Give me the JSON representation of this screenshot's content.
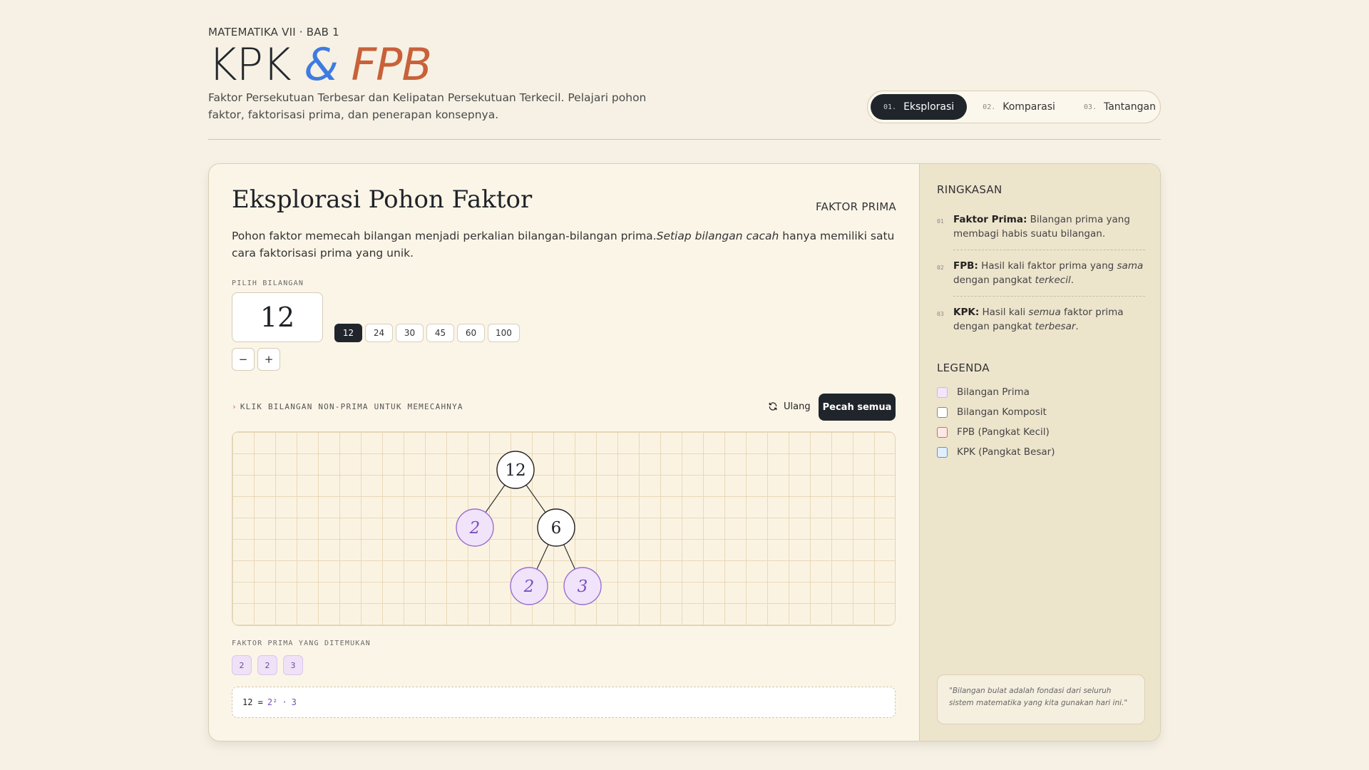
{
  "header": {
    "kicker": "MATEMATIKA VII · BAB 1",
    "title_a": "KPK ",
    "title_amp": "&",
    "title_b": " FPB",
    "subtitle": "Faktor Persekutuan Terbesar dan Kelipatan Persekutuan Terkecil. Pelajari pohon faktor, faktorisasi prima, dan penerapan konsepnya."
  },
  "tabs": [
    {
      "num": "01.",
      "label": "Eksplorasi",
      "active": true
    },
    {
      "num": "02.",
      "label": "Komparasi",
      "active": false
    },
    {
      "num": "03.",
      "label": "Tantangan",
      "active": false
    }
  ],
  "main": {
    "title": "Eksplorasi Pohon Faktor",
    "tag": "FAKTOR PRIMA",
    "para_a": "Pohon faktor memecah bilangan menjadi perkalian bilangan-bilangan prima.",
    "para_em": "Setiap bilangan cacah",
    "para_b": " hanya memiliki satu cara faktorisasi prima yang unik.",
    "pick_label": "PILIH BILANGAN",
    "value": "12",
    "minus": "−",
    "plus": "+",
    "presets": [
      "12",
      "24",
      "30",
      "45",
      "60",
      "100"
    ],
    "hint_arrow": "›",
    "hint": "KLIK BILANGAN NON-PRIMA UNTUK MEMECAHNYA",
    "reset_label": "Ulang",
    "split_all_label": "Pecah semua",
    "found_label": "FAKTOR PRIMA YANG DITEMUKAN",
    "found": [
      "2",
      "2",
      "3"
    ],
    "formula_lhs": "12 =",
    "formula_p1": "2²",
    "formula_dot": "·",
    "formula_p2": "3"
  },
  "tree": {
    "nodes": [
      {
        "label": "12",
        "kind": "composite"
      },
      {
        "label": "2",
        "kind": "prime"
      },
      {
        "label": "6",
        "kind": "composite"
      },
      {
        "label": "2",
        "kind": "prime"
      },
      {
        "label": "3",
        "kind": "prime"
      }
    ],
    "edges": [
      [
        0,
        1
      ],
      [
        0,
        2
      ],
      [
        2,
        3
      ],
      [
        2,
        4
      ]
    ]
  },
  "sidebar": {
    "summary_title": "RINGKASAN",
    "items": [
      {
        "num": "01",
        "term": "Faktor Prima:",
        "text": " Bilangan prima yang membagi habis suatu bilangan."
      },
      {
        "num": "02",
        "term": "FPB:",
        "t1": " Hasil kali faktor prima yang ",
        "e1": "sama",
        "t2": " dengan pangkat ",
        "e2": "terkecil",
        "t3": "."
      },
      {
        "num": "03",
        "term": "KPK:",
        "t1": " Hasil kali ",
        "e1": "semua",
        "t2": " faktor prima dengan pangkat ",
        "e2": "terbesar",
        "t3": "."
      }
    ],
    "legend_title": "LEGENDA",
    "legend": [
      {
        "label": "Bilangan Prima",
        "fill": "#f3e6fb",
        "border": "#d3b5ea"
      },
      {
        "label": "Bilangan Komposit",
        "fill": "#ffffff",
        "border": "#888888"
      },
      {
        "label": "FPB (Pangkat Kecil)",
        "fill": "#fde8e4",
        "border": "#d9695a"
      },
      {
        "label": "KPK (Pangkat Besar)",
        "fill": "#e1effc",
        "border": "#5b95d6"
      }
    ],
    "quote": "\"Bilangan bulat adalah fondasi dari seluruh sistem matematika yang kita gunakan hari ini.\""
  },
  "colors": {
    "accent_blue": "#3f7be0",
    "accent_orange": "#c8613a",
    "prime_purple": "#7a4fbf",
    "dark": "#1f252b"
  }
}
